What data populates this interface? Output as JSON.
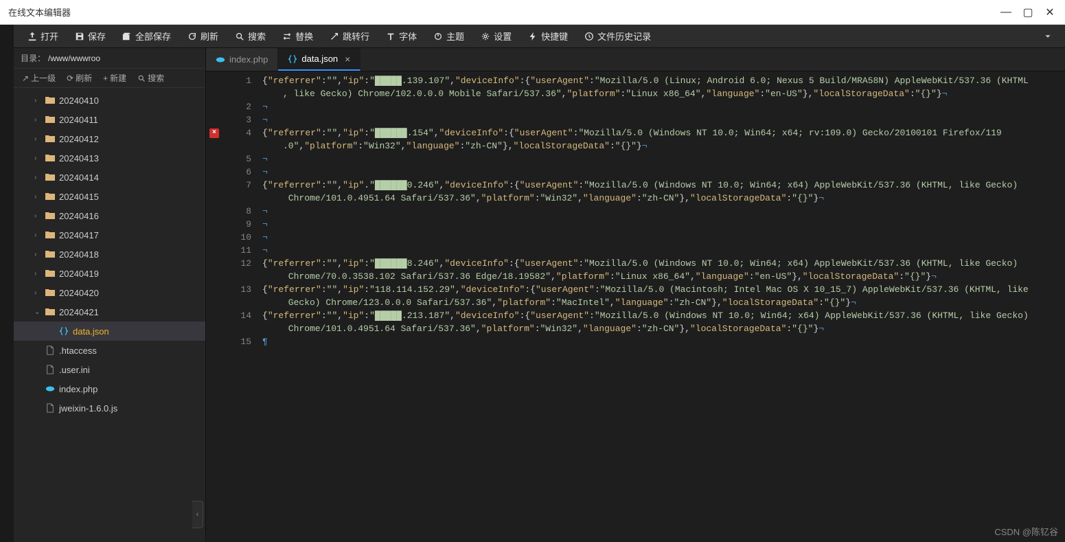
{
  "window": {
    "title": "在线文本编辑器"
  },
  "toolbar": {
    "open": "打开",
    "save": "保存",
    "saveAll": "全部保存",
    "refresh": "刷新",
    "search": "搜索",
    "replace": "替换",
    "goto": "跳转行",
    "font": "字体",
    "theme": "主题",
    "settings": "设置",
    "shortcut": "快捷键",
    "history": "文件历史记录"
  },
  "sidebar": {
    "path_label": "目录：",
    "path": "/www/wwwroo",
    "actions": {
      "up": "上一级",
      "refresh": "刷新",
      "new": "新建",
      "search": "搜索"
    },
    "tree": [
      {
        "type": "folder",
        "name": "20240410",
        "open": false,
        "depth": 1
      },
      {
        "type": "folder",
        "name": "20240411",
        "open": false,
        "depth": 1
      },
      {
        "type": "folder",
        "name": "20240412",
        "open": false,
        "depth": 1
      },
      {
        "type": "folder",
        "name": "20240413",
        "open": false,
        "depth": 1
      },
      {
        "type": "folder",
        "name": "20240414",
        "open": false,
        "depth": 1
      },
      {
        "type": "folder",
        "name": "20240415",
        "open": false,
        "depth": 1
      },
      {
        "type": "folder",
        "name": "20240416",
        "open": false,
        "depth": 1
      },
      {
        "type": "folder",
        "name": "20240417",
        "open": false,
        "depth": 1
      },
      {
        "type": "folder",
        "name": "20240418",
        "open": false,
        "depth": 1
      },
      {
        "type": "folder",
        "name": "20240419",
        "open": false,
        "depth": 1
      },
      {
        "type": "folder",
        "name": "20240420",
        "open": false,
        "depth": 1
      },
      {
        "type": "folder",
        "name": "20240421",
        "open": true,
        "depth": 1
      },
      {
        "type": "file-json",
        "name": "data.json",
        "depth": 2,
        "selected": true
      },
      {
        "type": "file",
        "name": ".htaccess",
        "depth": 1
      },
      {
        "type": "file",
        "name": ".user.ini",
        "depth": 1
      },
      {
        "type": "file-php",
        "name": "index.php",
        "depth": 1
      },
      {
        "type": "file",
        "name": "jweixin-1.6.0.js",
        "depth": 1
      }
    ]
  },
  "tabs": [
    {
      "label": "index.php",
      "icon": "php",
      "active": false
    },
    {
      "label": "data.json",
      "icon": "json",
      "active": true
    }
  ],
  "editor": {
    "error_line": 4,
    "lines": [
      {
        "n": 1,
        "segs": [
          {
            "t": "{",
            "c": "brace"
          },
          {
            "t": "\"referrer\"",
            "c": "key"
          },
          {
            "t": ":",
            "c": "punc"
          },
          {
            "t": "\"\"",
            "c": "str"
          },
          {
            "t": ",",
            "c": "punc"
          },
          {
            "t": "\"ip\"",
            "c": "key"
          },
          {
            "t": ":",
            "c": "punc"
          },
          {
            "t": "\"",
            "c": "str"
          },
          {
            "t": "█████",
            "c": "str"
          },
          {
            "t": ".139.107\"",
            "c": "str"
          },
          {
            "t": ",",
            "c": "punc"
          },
          {
            "t": "\"deviceInfo\"",
            "c": "key"
          },
          {
            "t": ":",
            "c": "punc"
          },
          {
            "t": "{",
            "c": "brace"
          },
          {
            "t": "\"userAgent\"",
            "c": "key"
          },
          {
            "t": ":",
            "c": "punc"
          },
          {
            "t": "\"Mozilla/5.0 (Linux; Android 6.0; Nexus 5 Build/MRA58N) AppleWebKit/537.36 (KHTML",
            "c": "str"
          }
        ]
      },
      {
        "n": 0,
        "wrap": true,
        "segs": [
          {
            "t": ", like Gecko) Chrome/102.0.0.0 Mobile Safari/537.36\"",
            "c": "str"
          },
          {
            "t": ",",
            "c": "punc"
          },
          {
            "t": "\"platform\"",
            "c": "key"
          },
          {
            "t": ":",
            "c": "punc"
          },
          {
            "t": "\"Linux x86_64\"",
            "c": "str"
          },
          {
            "t": ",",
            "c": "punc"
          },
          {
            "t": "\"language\"",
            "c": "key"
          },
          {
            "t": ":",
            "c": "punc"
          },
          {
            "t": "\"en-US\"",
            "c": "str"
          },
          {
            "t": "},",
            "c": "brace"
          },
          {
            "t": "\"localStorageData\"",
            "c": "key"
          },
          {
            "t": ":",
            "c": "punc"
          },
          {
            "t": "\"{}\"",
            "c": "str"
          },
          {
            "t": "}",
            "c": "brace"
          },
          {
            "t": "¬",
            "c": "para"
          }
        ]
      },
      {
        "n": 2,
        "segs": [
          {
            "t": "¬",
            "c": "para"
          }
        ]
      },
      {
        "n": 3,
        "segs": [
          {
            "t": "¬",
            "c": "para"
          }
        ]
      },
      {
        "n": 4,
        "segs": [
          {
            "t": "{",
            "c": "brace"
          },
          {
            "t": "\"referrer\"",
            "c": "key"
          },
          {
            "t": ":",
            "c": "punc"
          },
          {
            "t": "\"\"",
            "c": "str"
          },
          {
            "t": ",",
            "c": "punc"
          },
          {
            "t": "\"ip\"",
            "c": "key"
          },
          {
            "t": ":",
            "c": "punc"
          },
          {
            "t": "\"",
            "c": "str"
          },
          {
            "t": "██████",
            "c": "str"
          },
          {
            "t": ".154\"",
            "c": "str"
          },
          {
            "t": ",",
            "c": "punc"
          },
          {
            "t": "\"deviceInfo\"",
            "c": "key"
          },
          {
            "t": ":",
            "c": "punc"
          },
          {
            "t": "{",
            "c": "brace"
          },
          {
            "t": "\"userAgent\"",
            "c": "key"
          },
          {
            "t": ":",
            "c": "punc"
          },
          {
            "t": "\"Mozilla/5.0 (Windows NT 10.0; Win64; x64; rv:109.0) Gecko/20100101 Firefox/119",
            "c": "str"
          }
        ]
      },
      {
        "n": 0,
        "wrap": true,
        "segs": [
          {
            "t": ".0\"",
            "c": "str"
          },
          {
            "t": ",",
            "c": "punc"
          },
          {
            "t": "\"platform\"",
            "c": "key"
          },
          {
            "t": ":",
            "c": "punc"
          },
          {
            "t": "\"Win32\"",
            "c": "str"
          },
          {
            "t": ",",
            "c": "punc"
          },
          {
            "t": "\"language\"",
            "c": "key"
          },
          {
            "t": ":",
            "c": "punc"
          },
          {
            "t": "\"zh-CN\"",
            "c": "str"
          },
          {
            "t": "},",
            "c": "brace"
          },
          {
            "t": "\"localStorageData\"",
            "c": "key"
          },
          {
            "t": ":",
            "c": "punc"
          },
          {
            "t": "\"{}\"",
            "c": "str"
          },
          {
            "t": "}",
            "c": "brace"
          },
          {
            "t": "¬",
            "c": "para"
          }
        ]
      },
      {
        "n": 5,
        "segs": [
          {
            "t": "¬",
            "c": "para"
          }
        ]
      },
      {
        "n": 6,
        "segs": [
          {
            "t": "¬",
            "c": "para"
          }
        ]
      },
      {
        "n": 7,
        "segs": [
          {
            "t": "{",
            "c": "brace"
          },
          {
            "t": "\"referrer\"",
            "c": "key"
          },
          {
            "t": ":",
            "c": "punc"
          },
          {
            "t": "\"\"",
            "c": "str"
          },
          {
            "t": ",",
            "c": "punc"
          },
          {
            "t": "\"ip\"",
            "c": "key"
          },
          {
            "t": ".",
            "c": "punc"
          },
          {
            "t": "\"",
            "c": "str"
          },
          {
            "t": "██████",
            "c": "str"
          },
          {
            "t": "0.246\"",
            "c": "str"
          },
          {
            "t": ",",
            "c": "punc"
          },
          {
            "t": "\"deviceInfo\"",
            "c": "key"
          },
          {
            "t": ":",
            "c": "punc"
          },
          {
            "t": "{",
            "c": "brace"
          },
          {
            "t": "\"userAgent\"",
            "c": "key"
          },
          {
            "t": ":",
            "c": "punc"
          },
          {
            "t": "\"Mozilla/5.0 (Windows NT 10.0; Win64; x64) AppleWebKit/537.36 (KHTML, like Gecko)",
            "c": "str"
          }
        ]
      },
      {
        "n": 0,
        "wrap": true,
        "segs": [
          {
            "t": " Chrome/101.0.4951.64 Safari/537.36\"",
            "c": "str"
          },
          {
            "t": ",",
            "c": "punc"
          },
          {
            "t": "\"platform\"",
            "c": "key"
          },
          {
            "t": ":",
            "c": "punc"
          },
          {
            "t": "\"Win32\"",
            "c": "str"
          },
          {
            "t": ",",
            "c": "punc"
          },
          {
            "t": "\"language\"",
            "c": "key"
          },
          {
            "t": ":",
            "c": "punc"
          },
          {
            "t": "\"zh-CN\"",
            "c": "str"
          },
          {
            "t": "},",
            "c": "brace"
          },
          {
            "t": "\"localStorageData\"",
            "c": "key"
          },
          {
            "t": ":",
            "c": "punc"
          },
          {
            "t": "\"{}\"",
            "c": "str"
          },
          {
            "t": "}",
            "c": "brace"
          },
          {
            "t": "¬",
            "c": "para"
          }
        ]
      },
      {
        "n": 8,
        "segs": [
          {
            "t": "¬",
            "c": "para"
          }
        ]
      },
      {
        "n": 9,
        "segs": [
          {
            "t": "¬",
            "c": "para"
          }
        ]
      },
      {
        "n": 10,
        "segs": [
          {
            "t": "¬",
            "c": "para"
          }
        ]
      },
      {
        "n": 11,
        "segs": [
          {
            "t": "¬",
            "c": "para"
          }
        ]
      },
      {
        "n": 12,
        "segs": [
          {
            "t": "{",
            "c": "brace"
          },
          {
            "t": "\"referrer\"",
            "c": "key"
          },
          {
            "t": ":",
            "c": "punc"
          },
          {
            "t": "\"\"",
            "c": "str"
          },
          {
            "t": ",",
            "c": "punc"
          },
          {
            "t": "\"ip\"",
            "c": "key"
          },
          {
            "t": ":",
            "c": "punc"
          },
          {
            "t": "\"",
            "c": "str"
          },
          {
            "t": "██████",
            "c": "str"
          },
          {
            "t": "8.246\"",
            "c": "str"
          },
          {
            "t": ",",
            "c": "punc"
          },
          {
            "t": "\"deviceInfo\"",
            "c": "key"
          },
          {
            "t": ":",
            "c": "punc"
          },
          {
            "t": "{",
            "c": "brace"
          },
          {
            "t": "\"userAgent\"",
            "c": "key"
          },
          {
            "t": ":",
            "c": "punc"
          },
          {
            "t": "\"Mozilla/5.0 (Windows NT 10.0; Win64; x64) AppleWebKit/537.36 (KHTML, like Gecko)",
            "c": "str"
          }
        ]
      },
      {
        "n": 0,
        "wrap": true,
        "segs": [
          {
            "t": " Chrome/70.0.3538.102 Safari/537.36 Edge/18.19582\"",
            "c": "str"
          },
          {
            "t": ",",
            "c": "punc"
          },
          {
            "t": "\"platform\"",
            "c": "key"
          },
          {
            "t": ":",
            "c": "punc"
          },
          {
            "t": "\"Linux x86_64\"",
            "c": "str"
          },
          {
            "t": ",",
            "c": "punc"
          },
          {
            "t": "\"language\"",
            "c": "key"
          },
          {
            "t": ":",
            "c": "punc"
          },
          {
            "t": "\"en-US\"",
            "c": "str"
          },
          {
            "t": "},",
            "c": "brace"
          },
          {
            "t": "\"localStorageData\"",
            "c": "key"
          },
          {
            "t": ":",
            "c": "punc"
          },
          {
            "t": "\"{}\"",
            "c": "str"
          },
          {
            "t": "}",
            "c": "brace"
          },
          {
            "t": "¬",
            "c": "para"
          }
        ]
      },
      {
        "n": 13,
        "segs": [
          {
            "t": "{",
            "c": "brace"
          },
          {
            "t": "\"referrer\"",
            "c": "key"
          },
          {
            "t": ":",
            "c": "punc"
          },
          {
            "t": "\"\"",
            "c": "str"
          },
          {
            "t": ",",
            "c": "punc"
          },
          {
            "t": "\"ip\"",
            "c": "key"
          },
          {
            "t": ":",
            "c": "punc"
          },
          {
            "t": "\"118.114.152.29\"",
            "c": "str"
          },
          {
            "t": ",",
            "c": "punc"
          },
          {
            "t": "\"deviceInfo\"",
            "c": "key"
          },
          {
            "t": ":",
            "c": "punc"
          },
          {
            "t": "{",
            "c": "brace"
          },
          {
            "t": "\"userAgent\"",
            "c": "key"
          },
          {
            "t": ":",
            "c": "punc"
          },
          {
            "t": "\"Mozilla/5.0 (Macintosh; Intel Mac OS X 10_15_7) AppleWebKit/537.36 (KHTML, like",
            "c": "str"
          }
        ]
      },
      {
        "n": 0,
        "wrap": true,
        "segs": [
          {
            "t": " Gecko) Chrome/123.0.0.0 Safari/537.36\"",
            "c": "str"
          },
          {
            "t": ",",
            "c": "punc"
          },
          {
            "t": "\"platform\"",
            "c": "key"
          },
          {
            "t": ":",
            "c": "punc"
          },
          {
            "t": "\"MacIntel\"",
            "c": "str"
          },
          {
            "t": ",",
            "c": "punc"
          },
          {
            "t": "\"language\"",
            "c": "key"
          },
          {
            "t": ":",
            "c": "punc"
          },
          {
            "t": "\"zh-CN\"",
            "c": "str"
          },
          {
            "t": "},",
            "c": "brace"
          },
          {
            "t": "\"localStorageData\"",
            "c": "key"
          },
          {
            "t": ":",
            "c": "punc"
          },
          {
            "t": "\"{}\"",
            "c": "str"
          },
          {
            "t": "}",
            "c": "brace"
          },
          {
            "t": "¬",
            "c": "para"
          }
        ]
      },
      {
        "n": 14,
        "segs": [
          {
            "t": "{",
            "c": "brace"
          },
          {
            "t": "\"referrer\"",
            "c": "key"
          },
          {
            "t": ":",
            "c": "punc"
          },
          {
            "t": "\"\"",
            "c": "str"
          },
          {
            "t": ",",
            "c": "punc"
          },
          {
            "t": "\"ip\"",
            "c": "key"
          },
          {
            "t": ":",
            "c": "punc"
          },
          {
            "t": "\"",
            "c": "str"
          },
          {
            "t": "█████",
            "c": "str"
          },
          {
            "t": ".213.187\"",
            "c": "str"
          },
          {
            "t": ",",
            "c": "punc"
          },
          {
            "t": "\"deviceInfo\"",
            "c": "key"
          },
          {
            "t": ":",
            "c": "punc"
          },
          {
            "t": "{",
            "c": "brace"
          },
          {
            "t": "\"userAgent\"",
            "c": "key"
          },
          {
            "t": ":",
            "c": "punc"
          },
          {
            "t": "\"Mozilla/5.0 (Windows NT 10.0; Win64; x64) AppleWebKit/537.36 (KHTML, like Gecko)",
            "c": "str"
          }
        ]
      },
      {
        "n": 0,
        "wrap": true,
        "segs": [
          {
            "t": " Chrome/101.0.4951.64 Safari/537.36\"",
            "c": "str"
          },
          {
            "t": ",",
            "c": "punc"
          },
          {
            "t": "\"platform\"",
            "c": "key"
          },
          {
            "t": ":",
            "c": "punc"
          },
          {
            "t": "\"Win32\"",
            "c": "str"
          },
          {
            "t": ",",
            "c": "punc"
          },
          {
            "t": "\"language\"",
            "c": "key"
          },
          {
            "t": ":",
            "c": "punc"
          },
          {
            "t": "\"zh-CN\"",
            "c": "str"
          },
          {
            "t": "},",
            "c": "brace"
          },
          {
            "t": "\"localStorageData\"",
            "c": "key"
          },
          {
            "t": ":",
            "c": "punc"
          },
          {
            "t": "\"{}\"",
            "c": "str"
          },
          {
            "t": "}",
            "c": "brace"
          },
          {
            "t": "¬",
            "c": "para"
          }
        ]
      },
      {
        "n": 15,
        "segs": [
          {
            "t": "¶",
            "c": "para"
          }
        ]
      }
    ]
  },
  "watermark": "CSDN @陈钇谷"
}
